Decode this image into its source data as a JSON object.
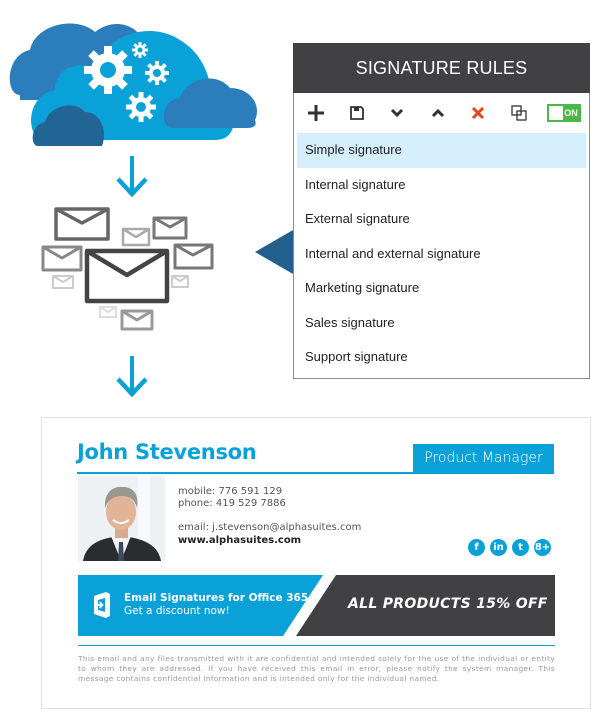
{
  "colors": {
    "accent": "#0aa1d8",
    "dark": "#414042",
    "pointer": "#235f8c",
    "toggle_green": "#4cb648",
    "delete_red": "#e2461c",
    "selected_row": "#d4eefb"
  },
  "illustration": {
    "cloud_icon": "cloud-gears-icon",
    "envelopes_icon": "envelopes-icon",
    "arrow_icon": "arrow-down-icon"
  },
  "rules_panel": {
    "title": "SIGNATURE RULES",
    "toolbar": [
      {
        "name": "add",
        "icon": "plus-icon"
      },
      {
        "name": "save",
        "icon": "floppy-icon"
      },
      {
        "name": "move-down",
        "icon": "chevron-down-icon"
      },
      {
        "name": "move-up",
        "icon": "chevron-up-icon"
      },
      {
        "name": "delete",
        "icon": "x-icon"
      },
      {
        "name": "duplicate",
        "icon": "copy-icon"
      }
    ],
    "toggle_label": "ON",
    "toggle_on": true,
    "items": [
      {
        "label": "Simple signature",
        "selected": true
      },
      {
        "label": "Internal signature",
        "selected": false
      },
      {
        "label": "External signature",
        "selected": false
      },
      {
        "label": "Internal and external signature",
        "selected": false
      },
      {
        "label": "Marketing signature",
        "selected": false
      },
      {
        "label": "Sales signature",
        "selected": false
      },
      {
        "label": "Support signature",
        "selected": false
      }
    ]
  },
  "signature": {
    "name": "John Stevenson",
    "title": "Product Manager",
    "mobile": "mobile: 776 591 129",
    "phone": "phone: 419 529 7886",
    "email": "email: j.stevenson@alphasuites.com",
    "website": "www.alphasuites.com",
    "social": [
      {
        "name": "facebook",
        "glyph": "f"
      },
      {
        "name": "linkedin",
        "glyph": "in"
      },
      {
        "name": "twitter",
        "glyph": "t"
      },
      {
        "name": "google-plus",
        "glyph": "8+"
      }
    ],
    "banner": {
      "line1": "Email Signatures for Office 365",
      "line2": "Get a discount now!",
      "offer": "ALL PRODUCTS 15% OFF"
    },
    "disclaimer": "This email and any files transmitted with it are confidential and intended solely for the use of the individual or entity to whom they are addressed. If you have received this email in error, please notify the system manager. This message contains confidential information and is intended only for the individual named."
  }
}
